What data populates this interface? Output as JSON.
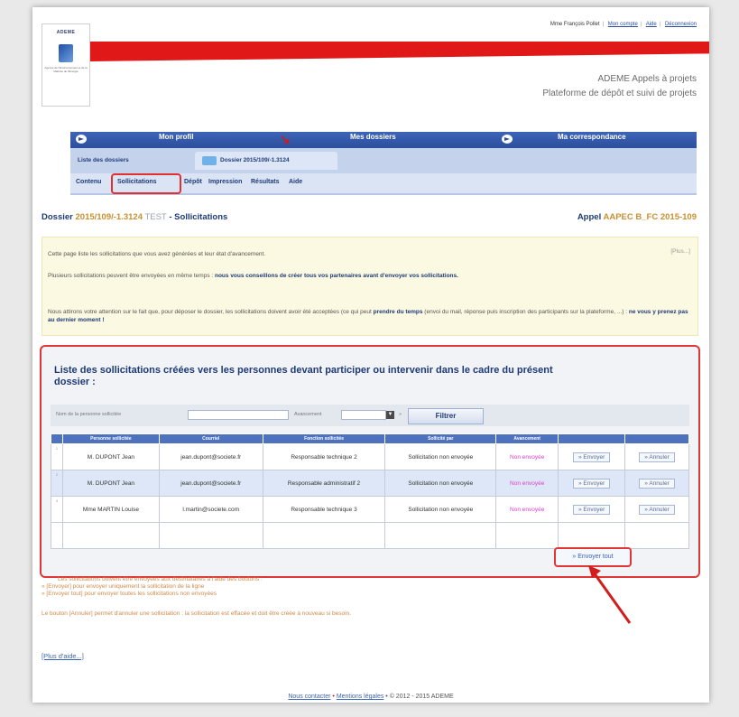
{
  "header": {
    "logo_text": "ADEME",
    "logo_sub": "Agence de l'Environnement et de la Maîtrise de l'Énergie",
    "user_name": "Mme François Pollet",
    "links": [
      "Mon compte",
      "Aide",
      "Déconnexion"
    ],
    "site_title_1": "ADEME Appels à projets",
    "site_title_2": "Plateforme de dépôt et suivi de projets"
  },
  "nav": {
    "profile": "Mon profil",
    "folders": "Mes dossiers",
    "mail": "Ma correspondance"
  },
  "subnav": {
    "list_label": "Liste des dossiers",
    "dossier_label": "Dossier 2015/109/-1.3124",
    "tabs": [
      "Contenu",
      "Sollicitations",
      "Dépôt",
      "Impression",
      "Résultats",
      "Aide"
    ]
  },
  "heading": {
    "prefix": "Dossier ",
    "dossier_num": "2015/109/-1.3124",
    "test": " TEST",
    "suffix": " - Sollicitations",
    "appel_prefix": "Appel ",
    "appel_code": "AAPEC B_FC 2015-109"
  },
  "info": {
    "line1": "Cette page liste les sollicitations que vous avez générées et leur état d'avancement.",
    "plus": "[Plus...]",
    "line2_plain": "Plusieurs sollicitations peuvent être envoyées en même temps : ",
    "line2_strong": "nous vous conseillons de créer tous vos partenaires avant d'envoyer vos sollicitations.",
    "line3_plain": "Nous attirons votre attention sur le fait que, pour déposer le dossier, les sollicitations doivent avoir été acceptées (ce qui peut ",
    "line3_strong": "prendre du temps",
    "line3_plain2": " (envoi du mail, réponse puis inscription des participants sur la plateforme, ...) : ",
    "line3_strong2": "ne vous y prenez pas au dernier moment !"
  },
  "panel": {
    "title": "Liste des sollicitations créées vers les personnes devant participer ou intervenir dans le cadre du présent dossier :",
    "filter_name_label": "Nom de la personne sollicitée",
    "filter_status_label": "Avancement",
    "filter_btn": "Filtrer",
    "columns": [
      "Personne sollicitée",
      "Courriel",
      "Fonction sollicitée",
      "Sollicité par",
      "Avancement",
      "",
      ""
    ],
    "rows": [
      {
        "num": "1",
        "person": "M. DUPONT Jean",
        "email": "jean.dupont@societe.fr",
        "role": "Responsable technique 2",
        "by": "Sollicitation non envoyée",
        "status": "Non envoyée",
        "send": "» Envoyer",
        "cancel": "» Annuler"
      },
      {
        "num": "2",
        "person": "M. DUPONT Jean",
        "email": "jean.dupont@societe.fr",
        "role": "Responsable administratif 2",
        "by": "Sollicitation non envoyée",
        "status": "Non envoyée",
        "send": "» Envoyer",
        "cancel": "» Annuler"
      },
      {
        "num": "3",
        "person": "Mme MARTIN Louise",
        "email": "l.martin@societe.com",
        "role": "Responsable technique 3",
        "by": "Sollicitation non envoyée",
        "status": "Non envoyée",
        "send": "» Envoyer",
        "cancel": "» Annuler"
      }
    ],
    "send_all": "» Envoyer tout"
  },
  "notes": {
    "line1": "Les sollicitations doivent être envoyées aux destinataires à l'aide des boutons :",
    "line2": "» [Envoyer] pour envoyer uniquement la sollicitation de la ligne",
    "line3": "» [Envoyer tout] pour envoyer toutes les sollicitations non envoyées",
    "line4": "Le bouton [Annuler] permet d'annuler une sollicitation : la sollicitation est effacée et doit être créée à nouveau si besoin."
  },
  "help_link": "[Plus d'aide...]",
  "footer": {
    "contact": "Nous contacter",
    "legal": "Mentions légales",
    "copyright": "• © 2012 - 2015 ADEME"
  },
  "colors": {
    "nav_blue": "#2b4f9c",
    "accent_red": "#e03636",
    "pink_status": "#e040c8"
  }
}
